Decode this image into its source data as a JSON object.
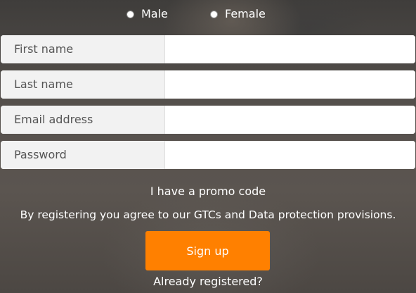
{
  "gender": {
    "male_label": "Male",
    "female_label": "Female"
  },
  "form": {
    "fields": [
      {
        "label": "First name",
        "value": ""
      },
      {
        "label": "Last name",
        "value": ""
      },
      {
        "label": "Email address",
        "value": ""
      },
      {
        "label": "Password",
        "value": ""
      }
    ]
  },
  "promo_link": "I have a promo code",
  "terms_text": "By registering you agree to our GTCs and Data protection provisions.",
  "signup_button": "Sign up",
  "already_registered_link": "Already registered?",
  "colors": {
    "accent": "#ff8000",
    "label_bg": "#f2f2f2",
    "input_bg": "#ffffff"
  }
}
